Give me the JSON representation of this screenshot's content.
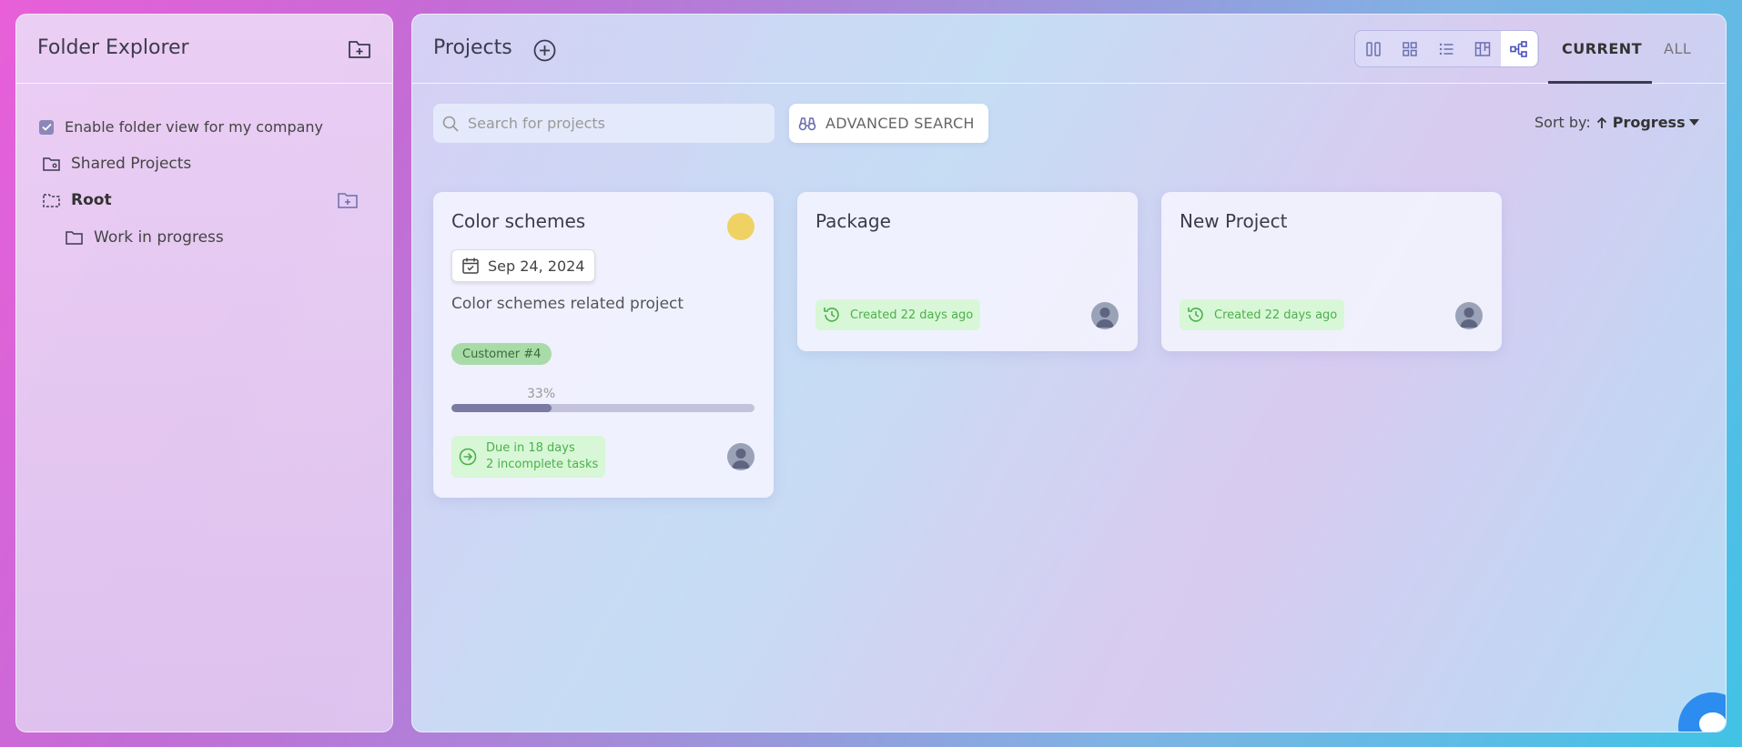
{
  "sidebar": {
    "title": "Folder Explorer",
    "enable_folder_view": {
      "label": "Enable folder view for my company",
      "checked": true
    },
    "tree": [
      {
        "label": "Shared Projects"
      },
      {
        "label": "Root"
      },
      {
        "label": "Work in progress"
      }
    ]
  },
  "main": {
    "title": "Projects",
    "view_modes": [
      "columns",
      "grid",
      "list",
      "board",
      "tree"
    ],
    "active_view": "tree",
    "tabs": {
      "current": "CURRENT",
      "all": "ALL",
      "active": "CURRENT"
    },
    "search": {
      "placeholder": "Search for projects",
      "value": ""
    },
    "advanced_search_label": "ADVANCED SEARCH",
    "sort": {
      "label": "Sort by:",
      "value": "Progress",
      "direction": "ascending"
    }
  },
  "projects": [
    {
      "title": "Color schemes",
      "status_color": "#f0d264",
      "date": "Sep 24, 2024",
      "description": "Color schemes related project",
      "tag": "Customer #4",
      "progress_label": "33%",
      "progress": 0.33,
      "due_line1": "Due in 18 days",
      "due_line2": "2 incomplete tasks"
    },
    {
      "title": "Package",
      "created": "Created 22 days ago"
    },
    {
      "title": "New Project",
      "created": "Created 22 days ago"
    }
  ],
  "colors": {
    "accent": "#5b5fc7",
    "chip_green_bg": "#d8f7d6",
    "chip_green_text": "#4bb04d",
    "progress_fill": "#7a7aa2",
    "chat_button": "#2d8cf0"
  }
}
